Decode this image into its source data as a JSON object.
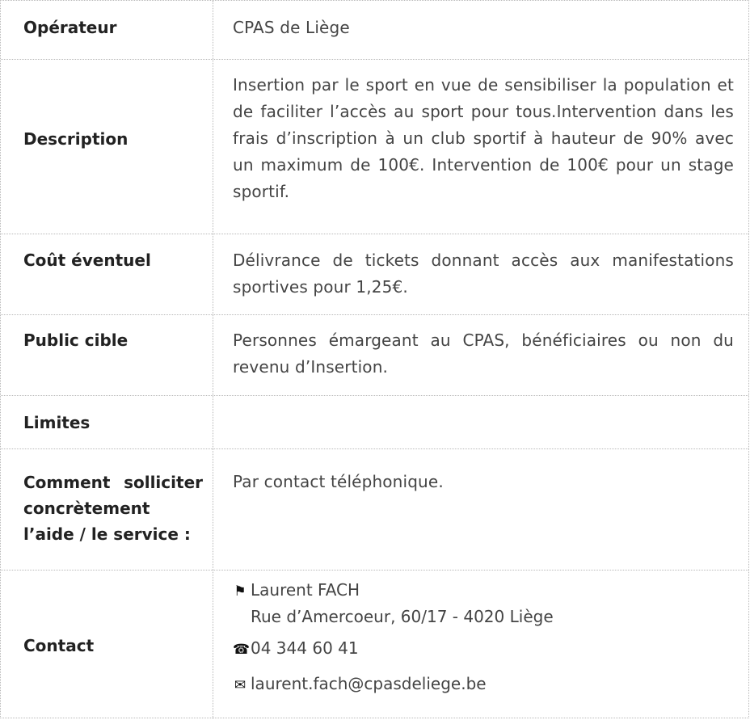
{
  "rows": {
    "operateur": {
      "label": "Opérateur",
      "value": "CPAS de Liège"
    },
    "description": {
      "label": "Description",
      "value": "Insertion par le sport en vue de sensibiliser la population et de faciliter l’accès au sport pour tous.Intervention dans les frais d’inscription à un club sportif à hauteur de 90% avec un maximum de 100€. Intervention de 100€ pour un stage sportif."
    },
    "cout": {
      "label": "Coût éventuel",
      "value": "Délivrance de tickets donnant accès aux manifestations sportives pour 1,25€."
    },
    "public": {
      "label": "Public cible",
      "value": "Personnes émargeant au CPAS, bénéficiaires ou non du revenu d’Insertion."
    },
    "limites": {
      "label": "Limites",
      "value": ""
    },
    "comment": {
      "label": "Comment solliciter concrètement l’aide / le service :",
      "value": "Par contact téléphonique."
    },
    "contact": {
      "label": "Contact",
      "name": "Laurent FACH",
      "address": "Rue d’Amercoeur, 60/17 - 4020 Liège",
      "phone": "04 344 60 41",
      "email": "laurent.fach@cpasdeliege.be"
    }
  },
  "icons": {
    "name": "flag-icon",
    "phone": "telephone-icon",
    "email": "envelope-icon"
  }
}
